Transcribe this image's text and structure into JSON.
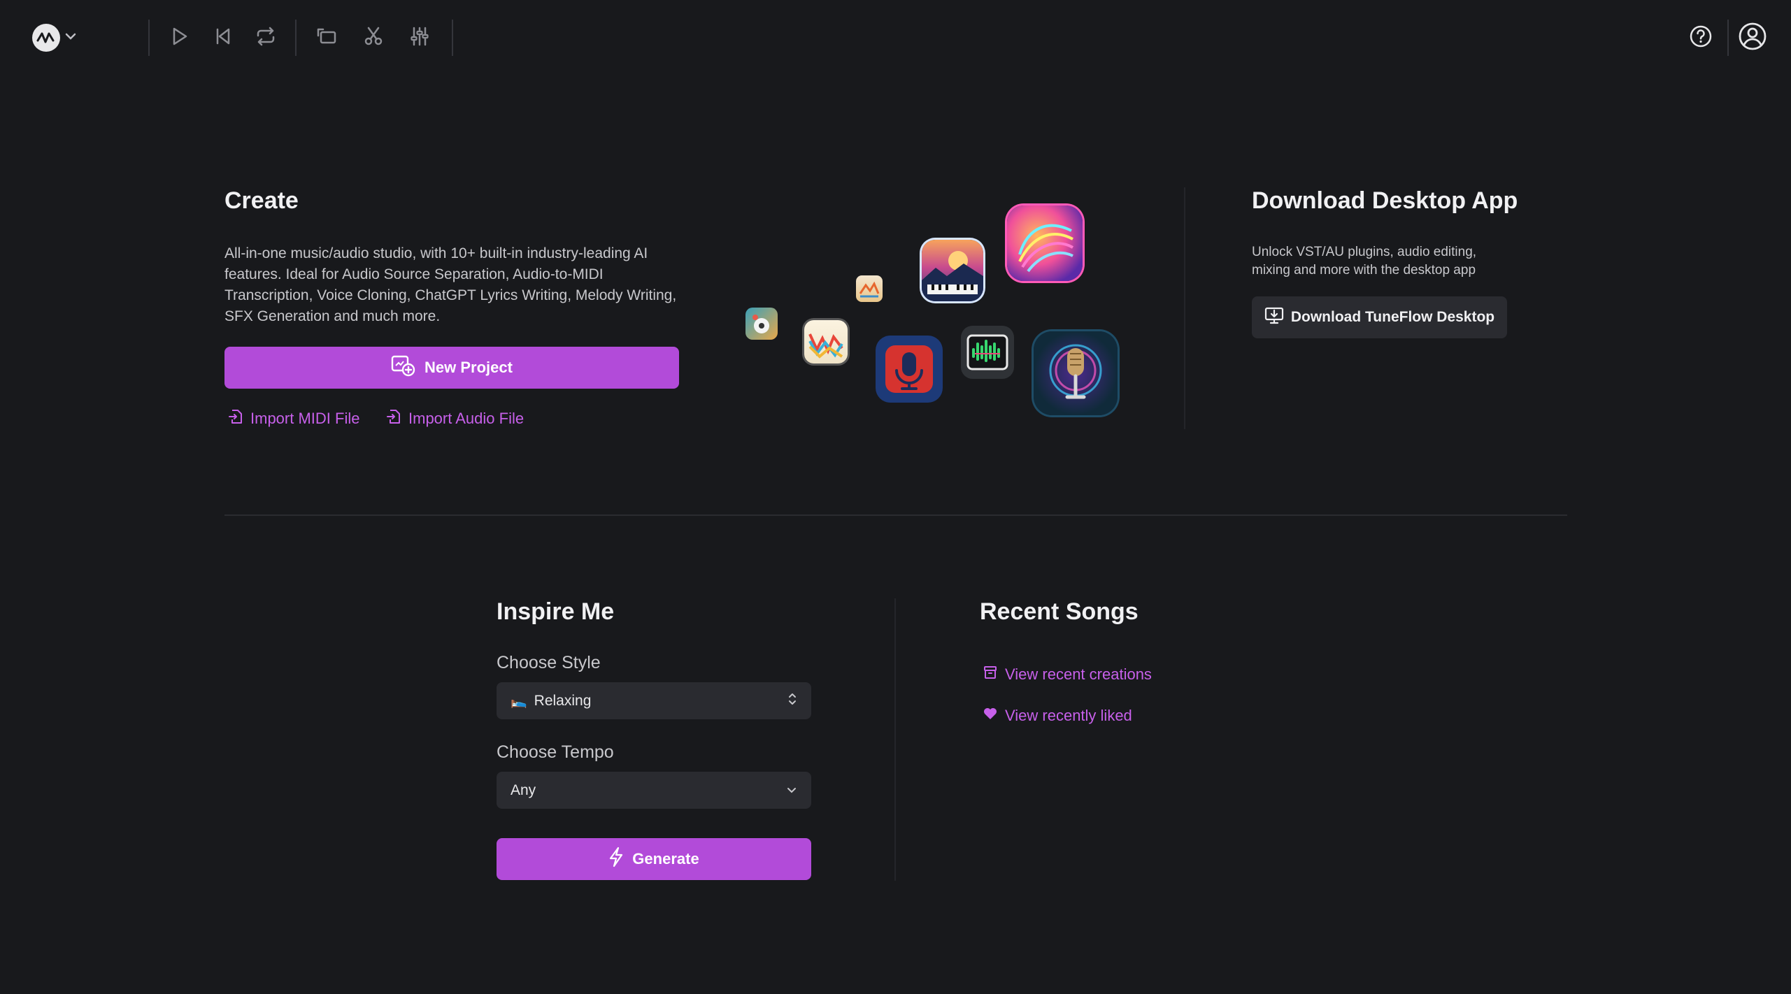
{
  "toolbar": {
    "icons": [
      "logo-icon",
      "chevron-down-icon",
      "play-icon",
      "skip-back-icon",
      "loop-icon",
      "clip-icon",
      "scissors-icon",
      "mixer-icon",
      "help-icon",
      "account-icon"
    ]
  },
  "create": {
    "title": "Create",
    "description": "All-in-one music/audio studio, with 10+ built-in industry-leading AI features. Ideal for Audio Source Separation, Audio-to-MIDI Transcription, Voice Cloning, ChatGPT Lyrics Writing, Melody Writing, SFX Generation and much more.",
    "new_project_label": "New Project",
    "import_midi_label": "Import MIDI File",
    "import_audio_label": "Import Audio File"
  },
  "download": {
    "title": "Download Desktop App",
    "description": "Unlock VST/AU plugins, audio editing, mixing and more with the desktop app",
    "button_label": "Download TuneFlow Desktop"
  },
  "inspire": {
    "title": "Inspire Me",
    "style_label": "Choose Style",
    "style_value": "Relaxing",
    "style_emoji": "🛌",
    "tempo_label": "Choose Tempo",
    "tempo_value": "Any",
    "generate_label": "Generate"
  },
  "recent": {
    "title": "Recent Songs",
    "view_creations_label": "View recent creations",
    "view_liked_label": "View recently liked"
  },
  "colors": {
    "accent": "#b24bd9",
    "link": "#c760ea",
    "background": "#18191c",
    "surface": "#2a2b30"
  }
}
